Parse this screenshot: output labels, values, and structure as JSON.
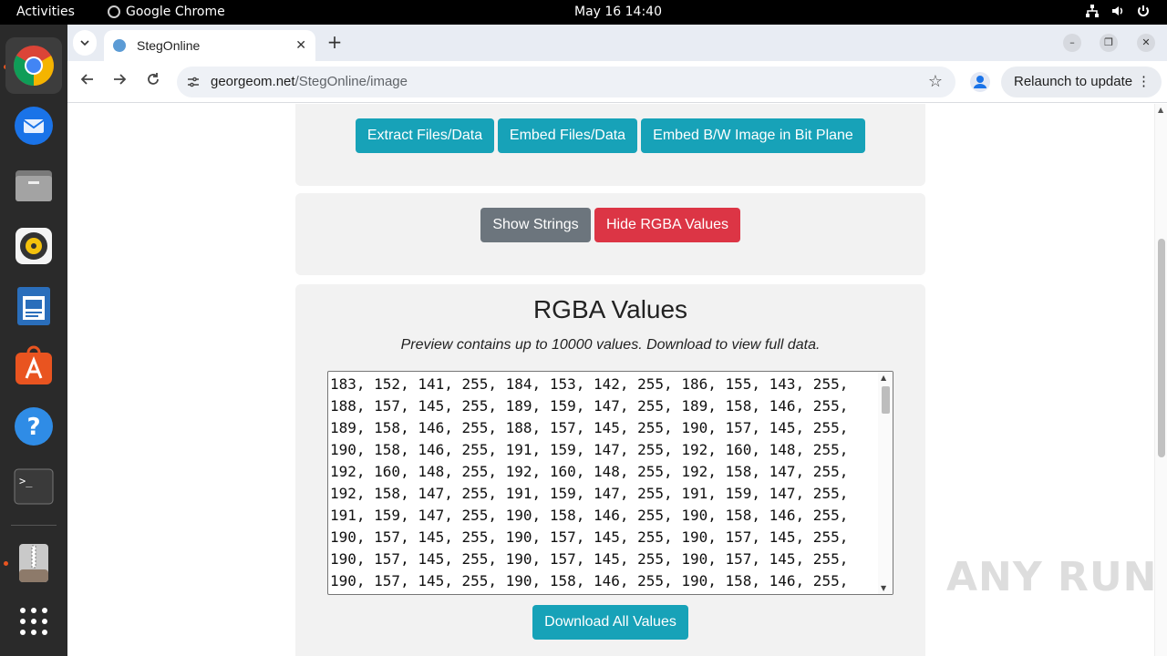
{
  "system": {
    "activities": "Activities",
    "app_name": "Google Chrome",
    "clock": "May 16  14:40"
  },
  "dock": {
    "items": [
      "chrome",
      "thunderbird",
      "files",
      "rhythmbox",
      "libreoffice-writer",
      "app-center",
      "help",
      "terminal",
      "archive-manager",
      "show-apps"
    ]
  },
  "browser": {
    "tab_title": "StegOnline",
    "url_domain": "georgeom.net",
    "url_path": "/StegOnline/image",
    "relaunch_label": "Relaunch to update"
  },
  "page": {
    "extract_label": "Extract Files/Data",
    "embed_label": "Embed Files/Data",
    "embed_bw_label": "Embed B/W Image in Bit Plane",
    "show_strings_label": "Show Strings",
    "hide_rgba_label": "Hide RGBA Values",
    "rgba_heading": "RGBA Values",
    "preview_note": "Preview contains up to 10000 values. Download to view full data.",
    "rgba_values": [
      "183, 152, 141, 255, 184, 153, 142, 255, 186, 155, 143, 255,",
      "188, 157, 145, 255, 189, 159, 147, 255, 189, 158, 146, 255,",
      "189, 158, 146, 255, 188, 157, 145, 255, 190, 157, 145, 255,",
      "190, 158, 146, 255, 191, 159, 147, 255, 192, 160, 148, 255,",
      "192, 160, 148, 255, 192, 160, 148, 255, 192, 158, 147, 255,",
      "192, 158, 147, 255, 191, 159, 147, 255, 191, 159, 147, 255,",
      "191, 159, 147, 255, 190, 158, 146, 255, 190, 158, 146, 255,",
      "190, 157, 145, 255, 190, 157, 145, 255, 190, 157, 145, 255,",
      "190, 157, 145, 255, 190, 157, 145, 255, 190, 157, 145, 255,",
      "190, 157, 145, 255, 190, 158, 146, 255, 190, 158, 146, 255,"
    ],
    "download_label": "Download All Values"
  },
  "watermark": "ANY RUN",
  "colors": {
    "teal": "#17a2b8",
    "gray": "#6c757d",
    "red": "#dc3545"
  }
}
